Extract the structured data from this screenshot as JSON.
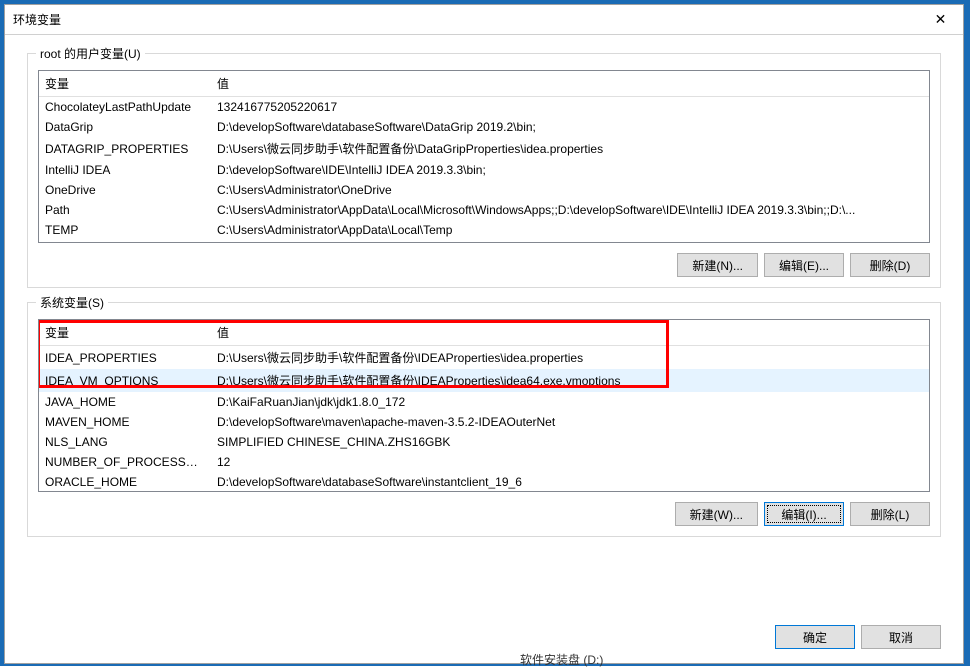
{
  "window": {
    "title": "环境变量"
  },
  "userVars": {
    "legend": "root 的用户变量(U)",
    "legendAccess": "U",
    "headers": {
      "name": "变量",
      "value": "值"
    },
    "rows": [
      {
        "name": "ChocolateyLastPathUpdate",
        "value": "132416775205220617"
      },
      {
        "name": "DataGrip",
        "value": "D:\\developSoftware\\databaseSoftware\\DataGrip 2019.2\\bin;"
      },
      {
        "name": "DATAGRIP_PROPERTIES",
        "value": "D:\\Users\\微云同步助手\\软件配置备份\\DataGripProperties\\idea.properties"
      },
      {
        "name": "IntelliJ IDEA",
        "value": "D:\\developSoftware\\IDE\\IntelliJ IDEA 2019.3.3\\bin;"
      },
      {
        "name": "OneDrive",
        "value": "C:\\Users\\Administrator\\OneDrive"
      },
      {
        "name": "Path",
        "value": "C:\\Users\\Administrator\\AppData\\Local\\Microsoft\\WindowsApps;;D:\\developSoftware\\IDE\\IntelliJ IDEA 2019.3.3\\bin;;D:\\..."
      },
      {
        "name": "TEMP",
        "value": "C:\\Users\\Administrator\\AppData\\Local\\Temp"
      }
    ],
    "buttons": {
      "new": "新建(N)...",
      "edit": "编辑(E)...",
      "delete": "删除(D)"
    }
  },
  "sysVars": {
    "legend": "系统变量(S)",
    "legendAccess": "S",
    "headers": {
      "name": "变量",
      "value": "值"
    },
    "rows": [
      {
        "name": "IDEA_PROPERTIES",
        "value": "D:\\Users\\微云同步助手\\软件配置备份\\IDEAProperties\\idea.properties"
      },
      {
        "name": "IDEA_VM_OPTIONS",
        "value": "D:\\Users\\微云同步助手\\软件配置备份\\IDEAProperties\\idea64.exe.vmoptions",
        "selected": true
      },
      {
        "name": "JAVA_HOME",
        "value": "D:\\KaiFaRuanJian\\jdk\\jdk1.8.0_172"
      },
      {
        "name": "MAVEN_HOME",
        "value": "D:\\developSoftware\\maven\\apache-maven-3.5.2-IDEAOuterNet"
      },
      {
        "name": "NLS_LANG",
        "value": "SIMPLIFIED CHINESE_CHINA.ZHS16GBK"
      },
      {
        "name": "NUMBER_OF_PROCESSORS",
        "value": "12"
      },
      {
        "name": "ORACLE_HOME",
        "value": "D:\\developSoftware\\databaseSoftware\\instantclient_19_6"
      }
    ],
    "buttons": {
      "new": "新建(W)...",
      "edit": "编辑(I)...",
      "delete": "删除(L)"
    }
  },
  "dialog": {
    "ok": "确定",
    "cancel": "取消"
  },
  "footer": {
    "partialText": "软件安装盘 (D:)"
  }
}
